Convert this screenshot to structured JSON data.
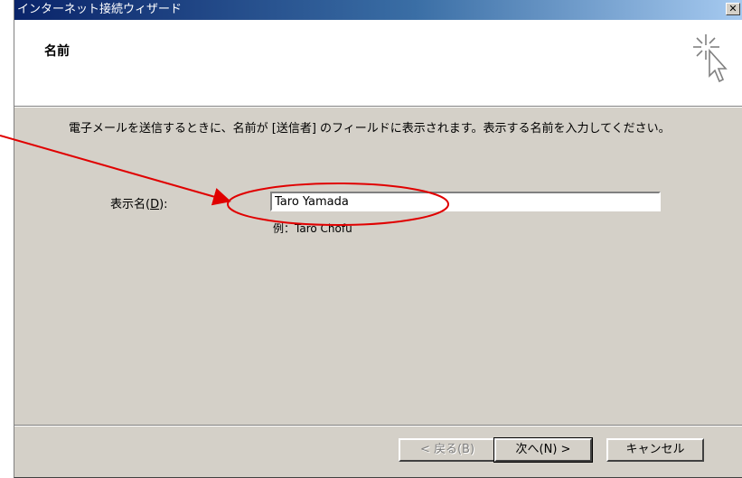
{
  "window": {
    "title": "インターネット接続ウィザード",
    "close_glyph": "✕"
  },
  "header": {
    "title": "名前",
    "icon": "wizard-sparkle-cursor-icon"
  },
  "body": {
    "description": "電子メールを送信するときに、名前が [送信者] のフィールドに表示されます。表示する名前を入力してください。",
    "field_label_prefix": "表示名(",
    "field_label_key": "D",
    "field_label_suffix": "):",
    "display_name_value": "Taro Yamada",
    "example": "例：Taro Chofu"
  },
  "buttons": {
    "back": "< 戻る(B)",
    "next": "次へ(N) >",
    "cancel": "キャンセル"
  },
  "annotation": {
    "color": "#e00000"
  }
}
